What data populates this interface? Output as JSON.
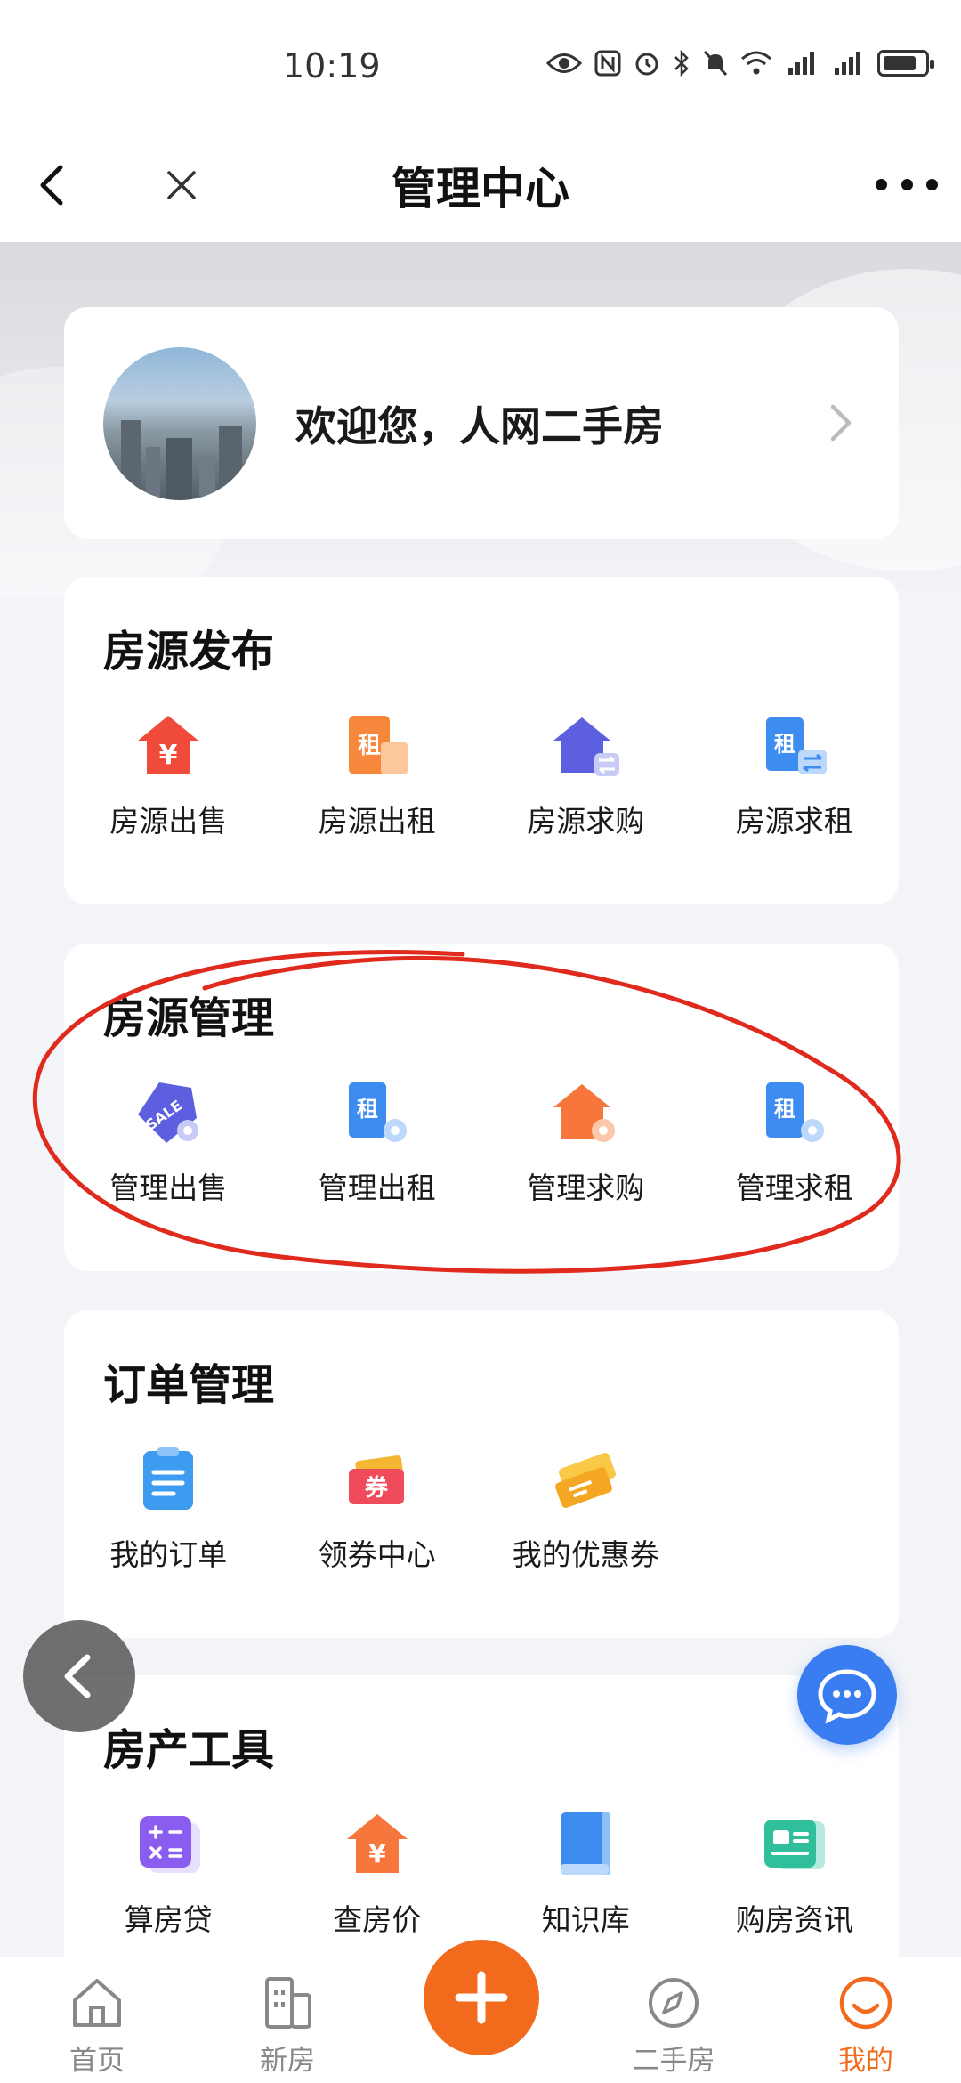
{
  "status": {
    "time": "10:19"
  },
  "header": {
    "title": "管理中心"
  },
  "welcome": {
    "text": "欢迎您，人网二手房"
  },
  "publish": {
    "title": "房源发布",
    "items": [
      {
        "label": "房源出售",
        "icon": "house-yuan-icon"
      },
      {
        "label": "房源出租",
        "icon": "rent-building-icon"
      },
      {
        "label": "房源求购",
        "icon": "house-exchange-icon"
      },
      {
        "label": "房源求租",
        "icon": "rent-exchange-icon"
      }
    ]
  },
  "manage": {
    "title": "房源管理",
    "items": [
      {
        "label": "管理出售",
        "icon": "sale-tag-gear-icon"
      },
      {
        "label": "管理出租",
        "icon": "rent-gear-icon"
      },
      {
        "label": "管理求购",
        "icon": "house-gear-icon"
      },
      {
        "label": "管理求租",
        "icon": "rent-doc-gear-icon"
      }
    ]
  },
  "orders": {
    "title": "订单管理",
    "items": [
      {
        "label": "我的订单",
        "icon": "clipboard-icon"
      },
      {
        "label": "领券中心",
        "icon": "coupon-icon",
        "badge": "券"
      },
      {
        "label": "我的优惠券",
        "icon": "tickets-icon"
      }
    ]
  },
  "tools": {
    "title": "房产工具",
    "items": [
      {
        "label": "算房贷",
        "icon": "calculator-icon"
      },
      {
        "label": "查房价",
        "icon": "house-price-icon"
      },
      {
        "label": "知识库",
        "icon": "book-icon"
      },
      {
        "label": "购房资讯",
        "icon": "news-icon"
      }
    ]
  },
  "tabbar": {
    "items": [
      {
        "label": "首页",
        "icon": "home-icon"
      },
      {
        "label": "新房",
        "icon": "building-icon"
      },
      {
        "label": "二手房",
        "icon": "compass-icon"
      },
      {
        "label": "我的",
        "icon": "smile-icon",
        "active": true
      }
    ]
  },
  "colors": {
    "accent": "#f26a1b",
    "chat": "#3a7df0",
    "annotation": "#e02a1d"
  }
}
